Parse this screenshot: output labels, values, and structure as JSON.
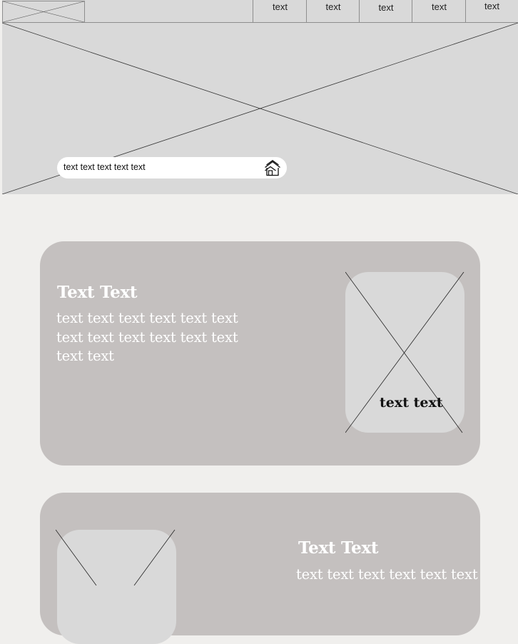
{
  "header": {
    "nav_items": [
      "text",
      "text",
      "text",
      "text",
      "text"
    ]
  },
  "hero": {
    "search": {
      "value": "text text text text text"
    },
    "search_icon": "home-icon"
  },
  "cards": [
    {
      "title": "Text Text",
      "text_lines": [
        "text text text text text text",
        "text text text text text text",
        "text text"
      ],
      "image_caption": "text text"
    },
    {
      "title": "Text Text",
      "text_lines": [
        "text text text text text text"
      ]
    }
  ],
  "colors": {
    "page_background": "#f0efed",
    "placeholder_gray": "#d9d9d9",
    "card_background": "#c4c0bf",
    "card_text": "#ffffff"
  }
}
